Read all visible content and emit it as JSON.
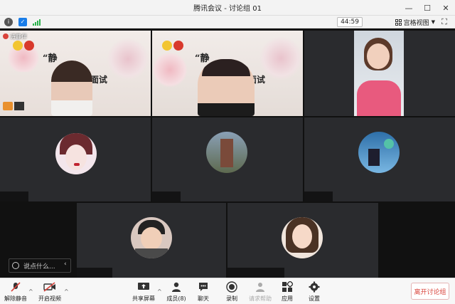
{
  "window": {
    "title": "腾讯会议 - 讨论组 01"
  },
  "controls": {
    "minimize": "—",
    "maximize": "☐",
    "close": "✕"
  },
  "info": {
    "timer": "44:59",
    "view_mode": "宫格视图"
  },
  "tiles": {
    "t1": {
      "badge": "诗静伴"
    },
    "banner": {
      "line1": "“静",
      "line2": "”面试"
    }
  },
  "chat": {
    "placeholder": "说点什么..."
  },
  "toolbar": {
    "unmute": "解除静音",
    "video": "开启视频",
    "share": "共享屏幕",
    "members": "成员(8)",
    "chat": "聊天",
    "record": "录制",
    "help": "请求帮助",
    "apps": "应用",
    "settings": "设置",
    "leave": "离开讨论组"
  },
  "colors": {
    "accent_red": "#d9433b",
    "toolbar_bg": "#f7f7f7"
  }
}
